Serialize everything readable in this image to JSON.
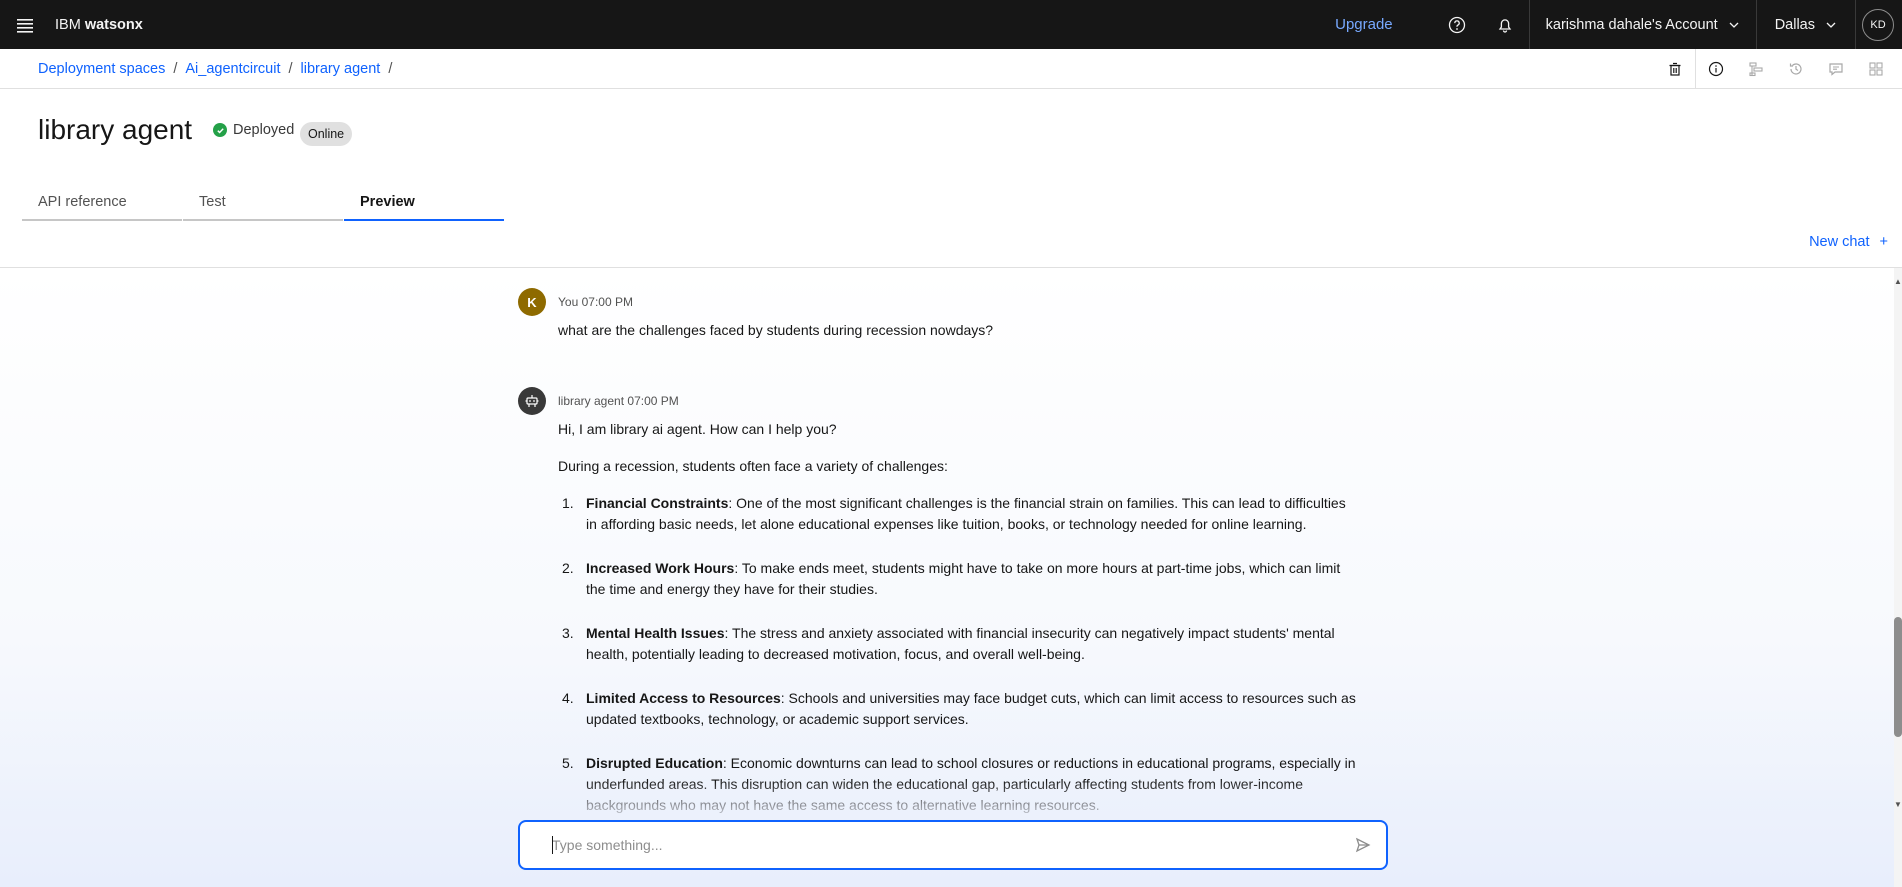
{
  "topbar": {
    "brand_prefix": "IBM",
    "brand_name": "watsonx",
    "upgrade_label": "Upgrade",
    "account_label": "karishma dahale's Account",
    "region_label": "Dallas",
    "user_initials": "KD"
  },
  "breadcrumb": {
    "items": [
      "Deployment spaces",
      "Ai_agentcircuit",
      "library agent"
    ],
    "separator": "/"
  },
  "header": {
    "title": "library agent",
    "status_label": "Deployed",
    "status_color": "#24a148",
    "tag_label": "Online"
  },
  "tabs": [
    {
      "label": "API reference",
      "active": false
    },
    {
      "label": "Test",
      "active": false
    },
    {
      "label": "Preview",
      "active": true
    }
  ],
  "new_chat_label": "New chat",
  "new_chat_icon": "+",
  "messages": [
    {
      "author": "You",
      "time": "07:00 PM",
      "avatar_initial": "K",
      "text": "what are the challenges faced by students during recession nowdays?"
    },
    {
      "author": "library agent",
      "time": "07:00 PM",
      "greeting": "Hi, I am library ai agent. How can I help you?",
      "intro": "During a recession, students often face a variety of challenges:",
      "items": [
        {
          "num": "1.",
          "title": "Financial Constraints",
          "text": ": One of the most significant challenges is the financial strain on families. This can lead to difficulties in affording basic needs, let alone educational expenses like tuition, books, or technology needed for online learning."
        },
        {
          "num": "2.",
          "title": "Increased Work Hours",
          "text": ": To make ends meet, students might have to take on more hours at part-time jobs, which can limit the time and energy they have for their studies."
        },
        {
          "num": "3.",
          "title": "Mental Health Issues",
          "text": ": The stress and anxiety associated with financial insecurity can negatively impact students' mental health, potentially leading to decreased motivation, focus, and overall well-being."
        },
        {
          "num": "4.",
          "title": "Limited Access to Resources",
          "text": ": Schools and universities may face budget cuts, which can limit access to resources such as updated textbooks, technology, or academic support services."
        },
        {
          "num": "5.",
          "title": "Disrupted Education",
          "text": ": Economic downturns can lead to school closures or reductions in educational programs, especially in underfunded areas. This disruption can widen the educational gap, particularly affecting students from lower-income backgrounds who may not have the same access to alternative learning resources."
        }
      ]
    }
  ],
  "composer": {
    "placeholder": "Type something...",
    "value": ""
  },
  "colors": {
    "accent": "#0f62fe",
    "topbar_bg": "#161616",
    "upgrade": "#78a9ff",
    "user_avatar": "#8e6a00"
  }
}
